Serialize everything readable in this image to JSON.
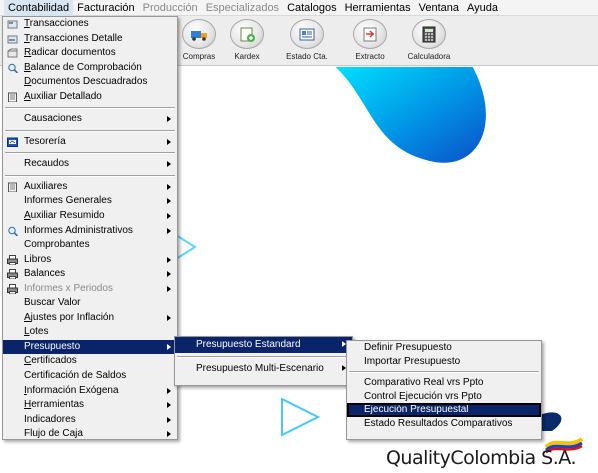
{
  "menubar": [
    {
      "label": "Contabilidad",
      "state": "active"
    },
    {
      "label": "Facturación",
      "state": "normal"
    },
    {
      "label": "Producción",
      "state": "disabled"
    },
    {
      "label": "Especializados",
      "state": "disabled"
    },
    {
      "label": "Catalogos",
      "state": "normal"
    },
    {
      "label": "Herramientas",
      "state": "normal"
    },
    {
      "label": "Ventana",
      "state": "normal"
    },
    {
      "label": "Ayuda",
      "state": "normal"
    }
  ],
  "toolbar": [
    {
      "label": "Compras",
      "icon": "truck-icon"
    },
    {
      "label": "Kardex",
      "icon": "kardex-icon"
    },
    {
      "label": "Estado Cta.",
      "icon": "account-statement-icon"
    },
    {
      "label": "Extracto",
      "icon": "statement-extract-icon"
    },
    {
      "label": "Calculadora",
      "icon": "calculator-icon"
    }
  ],
  "contabilidad_menu": [
    {
      "label": "Transacciones",
      "icon": "transactions-icon",
      "arrow": false
    },
    {
      "label": "Transacciones Detalle",
      "icon": "transactions-detail-icon",
      "arrow": false
    },
    {
      "label": "Radicar documentos",
      "icon": "file-documents-icon",
      "arrow": false
    },
    {
      "label": "Balance de Comprobación",
      "icon": "magnifier-icon",
      "arrow": false
    },
    {
      "label": "Documentos Descuadrados",
      "icon": "",
      "arrow": false
    },
    {
      "label": "Auxiliar Detallado",
      "icon": "ledger-icon",
      "arrow": false
    },
    {
      "sep": true
    },
    {
      "label": "Causaciones",
      "icon": "",
      "arrow": true
    },
    {
      "sep": true
    },
    {
      "label": "Tesorería",
      "icon": "treasury-icon",
      "arrow": true
    },
    {
      "sep": true
    },
    {
      "label": "Recaudos",
      "icon": "",
      "arrow": true
    },
    {
      "sep": true
    },
    {
      "label": "Auxiliares",
      "icon": "ledger-icon",
      "arrow": true
    },
    {
      "label": "Informes Generales",
      "icon": "",
      "arrow": true
    },
    {
      "label": "Auxiliar Resumido",
      "icon": "",
      "arrow": true
    },
    {
      "label": "Informes Administrativos",
      "icon": "magnifier-icon",
      "arrow": true
    },
    {
      "label": "Comprobantes",
      "icon": "",
      "arrow": false
    },
    {
      "label": "Libros",
      "icon": "printer-icon",
      "arrow": true
    },
    {
      "label": "Balances",
      "icon": "printer-icon",
      "arrow": true
    },
    {
      "label": "Informes x Periodos",
      "icon": "printer-icon",
      "arrow": true,
      "disabled": true
    },
    {
      "label": "Buscar Valor",
      "icon": "",
      "arrow": false
    },
    {
      "label": "Ajustes por Inflación",
      "icon": "",
      "arrow": true
    },
    {
      "label": "Lotes",
      "icon": "",
      "arrow": false
    },
    {
      "label": "Presupuesto",
      "icon": "",
      "arrow": true,
      "highlight": true
    },
    {
      "label": "Certificados",
      "icon": "",
      "arrow": false
    },
    {
      "label": "Certificación de Saldos",
      "icon": "",
      "arrow": false
    },
    {
      "label": "Información Exógena",
      "icon": "",
      "arrow": true
    },
    {
      "label": "Herramientas",
      "icon": "",
      "arrow": true
    },
    {
      "label": "Indicadores",
      "icon": "",
      "arrow": true
    },
    {
      "label": "Flujo de Caja",
      "icon": "",
      "arrow": true
    }
  ],
  "presupuesto_menu": [
    {
      "label": "Presupuesto  Estandard",
      "arrow": true,
      "highlight": true
    },
    {
      "sep": true
    },
    {
      "label": "Presupuesto Multi-Escenario",
      "arrow": true
    }
  ],
  "estandard_menu": [
    {
      "label": "Definir Presupuesto"
    },
    {
      "label": "Importar Presupuesto"
    },
    {
      "sep": true
    },
    {
      "label": "Comparativo  Real vrs Ppto"
    },
    {
      "label": "Control Ejecución vrs Ppto"
    },
    {
      "label": "Ejecución Presupuestal",
      "highlight": true
    },
    {
      "label": "Estado Resultados Comparativos"
    }
  ],
  "branding": {
    "company": "QualityColombia S.A."
  },
  "colors": {
    "highlight": "#0a246a",
    "menu_bg": "#f0f0f0",
    "accent_cyan": "#00c8f0"
  }
}
